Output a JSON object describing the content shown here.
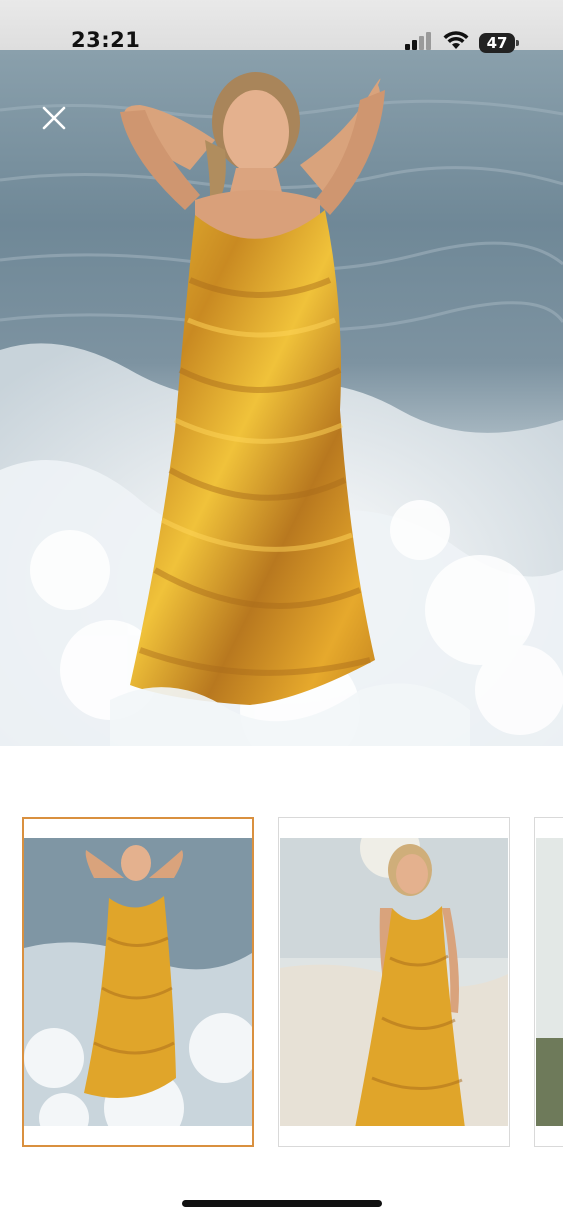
{
  "status_bar": {
    "time": "23:21",
    "battery": "47",
    "icons": [
      "signal-bars-icon",
      "wifi-icon",
      "battery-icon"
    ]
  },
  "viewer": {
    "close_icon": "close-icon",
    "main_image": "woman-yellow-dress-in-surf"
  },
  "thumbnails": [
    {
      "image": "woman-yellow-dress-arms-raised-in-waves",
      "selected": true
    },
    {
      "image": "woman-yellow-dress-walking-beach",
      "selected": false
    },
    {
      "image": "partial-third-thumbnail",
      "selected": false
    }
  ],
  "colors": {
    "selected_border": "#d9903f",
    "dress": "#e0a52a",
    "sea": "#7d93a1",
    "foam": "#e9eef1"
  }
}
